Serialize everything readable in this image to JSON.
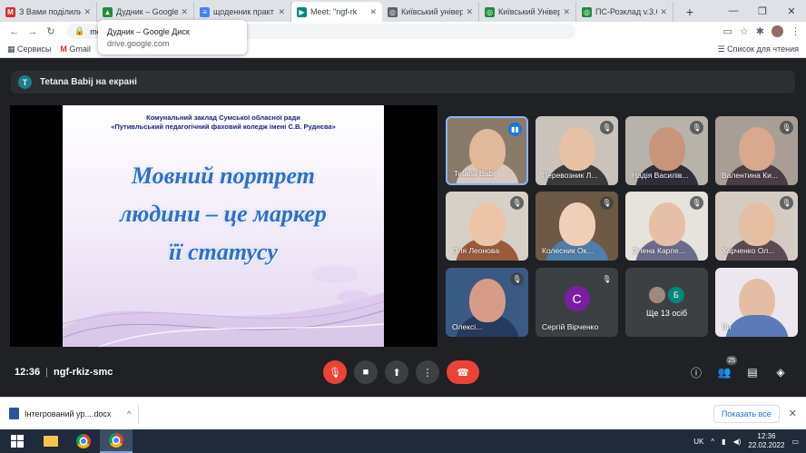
{
  "browser": {
    "tabs": [
      {
        "title": "З Вами поділилис",
        "fav_color": "#d93025",
        "fav_glyph": "M",
        "active": false
      },
      {
        "title": "Дудник – Google Д",
        "fav_color": "#1e8e3e",
        "fav_glyph": "▲",
        "active": false
      },
      {
        "title": "щоденник практ",
        "fav_color": "#4285f4",
        "fav_glyph": "≡",
        "active": false
      },
      {
        "title": "Meet: \"ngf-rk",
        "fav_color": "#00897b",
        "fav_glyph": "▶",
        "active": true
      },
      {
        "title": "Київський універ",
        "fav_color": "#5f6368",
        "fav_glyph": "◎",
        "active": false
      },
      {
        "title": "Київський Універ",
        "fav_color": "#1e8e3e",
        "fav_glyph": "◎",
        "active": false
      },
      {
        "title": "ПС-Розклад v.3.6",
        "fav_color": "#1e8e3e",
        "fav_glyph": "◎",
        "active": false
      }
    ],
    "url": "me",
    "bookmarks": {
      "apps": "Сервисы",
      "gmail": "Gmail",
      "reading_list": "Список для чтения"
    }
  },
  "tooltip": {
    "title": "Дудник – Google Диск",
    "domain": "drive.google.com"
  },
  "presenting": {
    "avatar_letter": "T",
    "text": "Tetana Babij на екрані"
  },
  "slide": {
    "org_line1": "Комунальний заклад Сумської обласної ради",
    "org_line2": "«Путивльський педагогічний фаховий коледж імені С.В. Руднєва»",
    "title_line1": "Мовний портрет",
    "title_line2": "людини – це маркер",
    "title_line3": "її статусу"
  },
  "participants": [
    {
      "name": "Tetana Babij",
      "speaking": true,
      "bg": "#8a7a6a",
      "face": "#e2b89a",
      "body": "#d8c8c0"
    },
    {
      "name": "Перевозник Л...",
      "speaking": false,
      "bg": "#c9c3bb",
      "face": "#e7c2a4",
      "body": "#3a3a3a"
    },
    {
      "name": "Надія Василів...",
      "speaking": false,
      "bg": "#b7b2aa",
      "face": "#c8957a",
      "body": "#2e2e38"
    },
    {
      "name": "Валентина Ки...",
      "speaking": false,
      "bg": "#a89e96",
      "face": "#d9a88d",
      "body": "#4a3e44"
    },
    {
      "name": "Оля Леонова",
      "speaking": false,
      "bg": "#d6d0c6",
      "face": "#eac5a8",
      "body": "#9b5a3a"
    },
    {
      "name": "Колесник Ок...",
      "speaking": false,
      "bg": "#6d5a46",
      "face": "#f0cfb6",
      "body": "#4e7fa8"
    },
    {
      "name": "Олена Карпе...",
      "speaking": false,
      "bg": "#e6e2dc",
      "face": "#e5c0a6",
      "body": "#6b6b8a"
    },
    {
      "name": "Харченко Ол...",
      "speaking": false,
      "bg": "#d4cbc3",
      "face": "#e4bfa4",
      "body": "#5c4a52"
    },
    {
      "name": "Олексі...",
      "speaking": false,
      "bg": "#3a5a86",
      "face": "#d89c86",
      "body": "#243a5e"
    }
  ],
  "avatar_tile": {
    "letter": "С",
    "name": "Сергій Вірченко"
  },
  "others_tile": {
    "badge_letter": "Б",
    "label": "Ще 13 осіб"
  },
  "last_tile": {
    "name": "Ви",
    "bg": "#ece7ee",
    "face": "#e3bda4",
    "body": "#5a7ab8"
  },
  "meeting": {
    "time": "12:36",
    "separator": "|",
    "code": "ngf-rkiz-smc"
  },
  "participants_count": "25",
  "download": {
    "filename": "Інтегрований ур....docx",
    "show_all": "Показать все"
  },
  "taskbar": {
    "lang": "UK",
    "time": "12:36",
    "date": "22.02.2022"
  }
}
